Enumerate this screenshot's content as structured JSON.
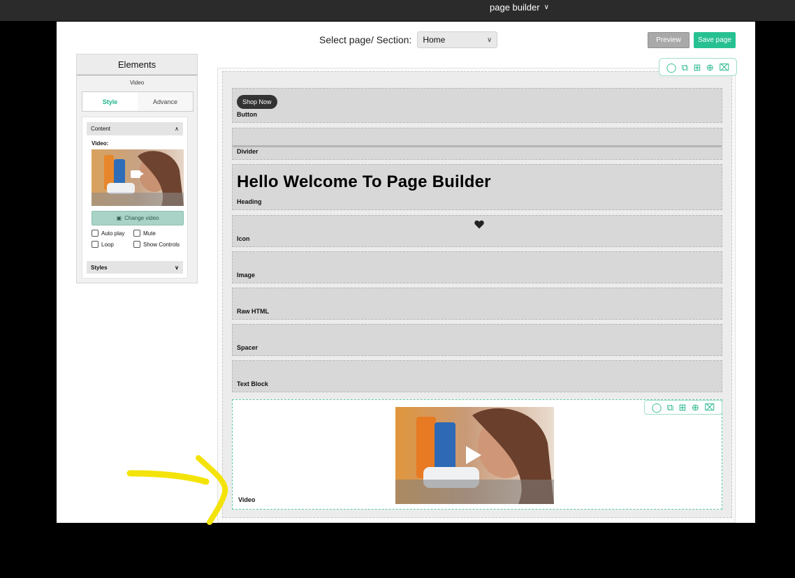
{
  "topbar": {
    "menu_label": "page builder"
  },
  "header": {
    "select_label": "Select page/ Section:",
    "select_value": "Home",
    "preview_label": "Preview",
    "save_label": "Save page"
  },
  "panel": {
    "title": "Elements",
    "subtitle": "Video",
    "tabs": [
      {
        "label": "Style"
      },
      {
        "label": "Advance"
      }
    ],
    "content_section": "Content",
    "video_label": "Video:",
    "change_video_label": "Change video",
    "options": [
      {
        "label": "Auto play"
      },
      {
        "label": "Mute"
      },
      {
        "label": "Loop"
      },
      {
        "label": "Show Controls"
      }
    ],
    "styles_section": "Styles"
  },
  "canvas": {
    "blocks": {
      "button": {
        "label": "Button",
        "button_text": "Shop Now"
      },
      "divider": {
        "label": "Divider"
      },
      "heading": {
        "label": "Heading",
        "text": "Hello Welcome To Page Builder"
      },
      "icon": {
        "label": "Icon"
      },
      "image": {
        "label": "Image"
      },
      "raw_html": {
        "label": "Raw HTML"
      },
      "spacer": {
        "label": "Spacer"
      },
      "text_block": {
        "label": "Text Block"
      },
      "video": {
        "label": "Video"
      }
    }
  },
  "colors": {
    "accent": "#27c091",
    "block_bg": "#d8d8d8",
    "topbar": "#2b2b2b"
  }
}
